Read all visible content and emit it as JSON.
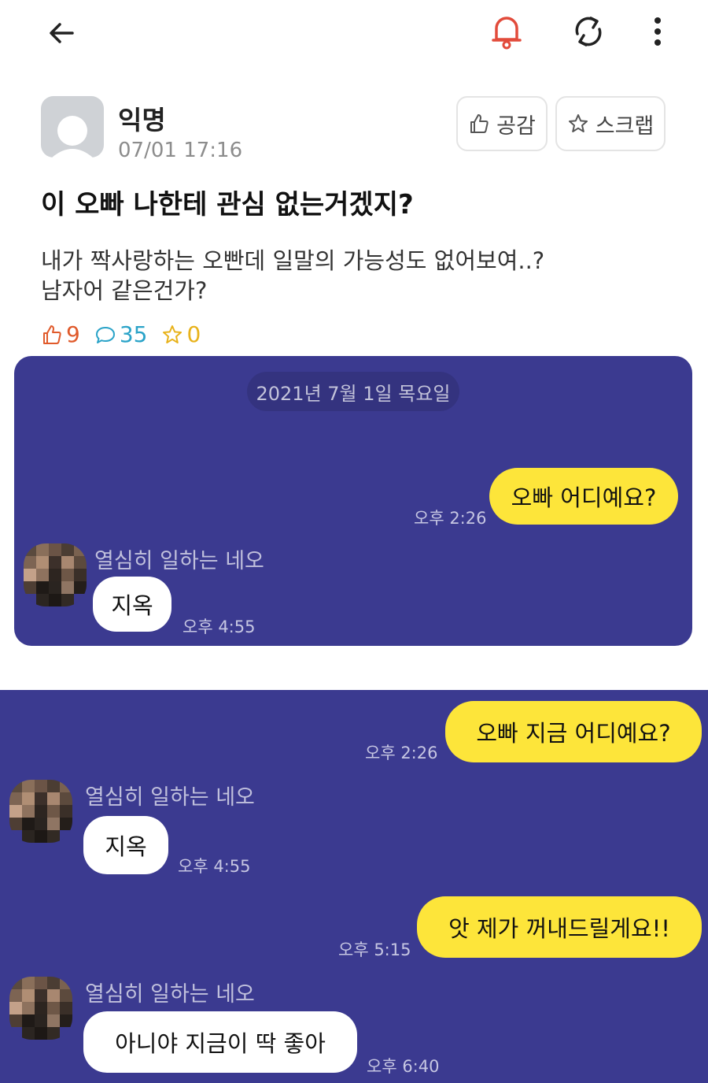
{
  "post": {
    "author": "익명",
    "time": "07/01 17:16",
    "like_button": "공감",
    "scrap_button": "스크랩",
    "title": "이 오빠 나한테 관심 없는거겠지?",
    "body_line1": "내가 짝사랑하는 오빤데 일말의 가능성도 없어보여..?",
    "body_line2": "남자어 같은건가?",
    "stats": {
      "likes": "9",
      "comments": "35",
      "scraps": "0"
    }
  },
  "chat1": {
    "date": "2021년 7월 1일 목요일",
    "messages": [
      {
        "side": "me",
        "text": "오빠 어디예요?",
        "time": "오후 2:26"
      },
      {
        "side": "them",
        "sender": "열심히 일하는 네오",
        "text": "지옥",
        "time": "오후 4:55"
      }
    ]
  },
  "chat2": {
    "messages": [
      {
        "side": "me",
        "text": "오빠 지금 어디예요?",
        "time": "오후 2:26"
      },
      {
        "side": "them",
        "sender": "열심히 일하는 네오",
        "text": "지옥",
        "time": "오후 4:55"
      },
      {
        "side": "me",
        "text": "앗 제가 꺼내드릴게요!!",
        "time": "오후 5:15"
      },
      {
        "side": "them",
        "sender": "열심히 일하는 네오",
        "text": "아니야 지금이 딱 좋아",
        "time": "오후 6:40"
      }
    ]
  },
  "colors": {
    "chat_bg": "#3b3a90",
    "my_bubble": "#fde53a",
    "their_bubble": "#ffffff",
    "alert_bell": "#e24b3b",
    "like_stat": "#e05a2b",
    "comment_stat": "#2aa3c8",
    "scrap_stat": "#e8b21a"
  },
  "icons": [
    "back-arrow-icon",
    "bell-icon",
    "refresh-icon",
    "more-vertical-icon",
    "thumbs-up-icon",
    "star-icon",
    "comment-icon"
  ]
}
